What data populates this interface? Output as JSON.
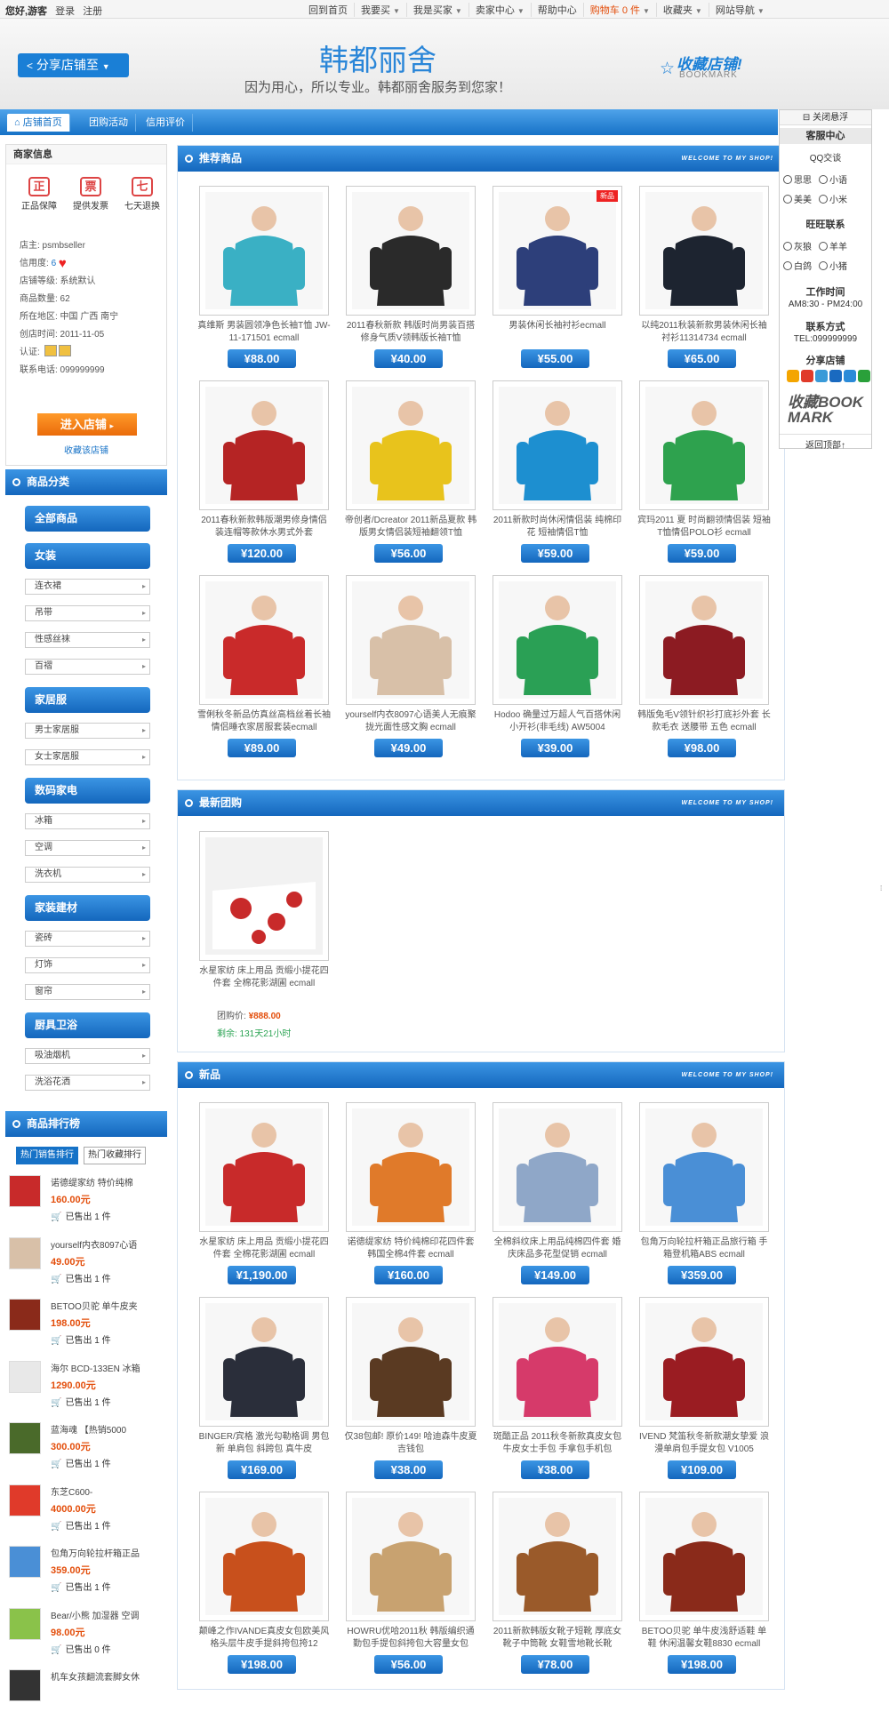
{
  "topbar": {
    "greeting": "您好,游客",
    "login": "登录",
    "register": "注册",
    "links": [
      "回到首页",
      "我要买",
      "我是买家",
      "卖家中心",
      "帮助中心",
      "购物车 0 件",
      "收藏夹",
      "网站导航"
    ]
  },
  "header": {
    "share": "分享店铺至",
    "store_name": "韩都丽舍",
    "slogan": "因为用心，所以专业。韩都丽舍服务到您家！",
    "fav_title": "收藏店铺!",
    "fav_sub": "BOOKMARK"
  },
  "nav": {
    "items": [
      "店铺首页",
      "团购活动",
      "信用评价"
    ]
  },
  "merchant": {
    "heading": "商家信息",
    "badges": [
      "正品保障",
      "提供发票",
      "七天退换"
    ],
    "owner": "店主: psmbseller",
    "credit_label": "信用度:",
    "credit_value": "6",
    "level": "店铺等级: 系统默认",
    "count": "商品数量: 62",
    "region": "所在地区: 中国  广西  南宁",
    "created": "创店时间: 2011-11-05",
    "cert": "认证:",
    "phone": "联系电话: 099999999",
    "enter": "进入店铺",
    "fav": "收藏该店铺"
  },
  "categories": {
    "heading": "商品分类",
    "groups": [
      {
        "name": "全部商品",
        "subs": []
      },
      {
        "name": "女装",
        "subs": [
          "连衣裙",
          "吊带",
          "性感丝袜",
          "百褶"
        ]
      },
      {
        "name": "家居服",
        "subs": [
          "男士家居服",
          "女士家居服"
        ]
      },
      {
        "name": "数码家电",
        "subs": [
          "冰箱",
          "空调",
          "洗衣机"
        ]
      },
      {
        "name": "家装建材",
        "subs": [
          "瓷砖",
          "灯饰",
          "窗帘"
        ]
      },
      {
        "name": "厨具卫浴",
        "subs": [
          "吸油烟机",
          "洗浴花洒"
        ]
      }
    ]
  },
  "ranking": {
    "heading": "商品排行榜",
    "tabs": [
      "热门销售排行",
      "热门收藏排行"
    ],
    "sold_label": "已售出",
    "items": [
      {
        "name": "诺德缇家纺 特价纯棉",
        "price": "160.00元",
        "sold": "1 件"
      },
      {
        "name": "yourself内衣8097心语",
        "price": "49.00元",
        "sold": "1 件"
      },
      {
        "name": "BETOO贝驼 单牛皮夹",
        "price": "198.00元",
        "sold": "1 件"
      },
      {
        "name": "海尔 BCD-133EN 冰箱",
        "price": "1290.00元",
        "sold": "1 件"
      },
      {
        "name": "蓝海魂 【热销5000",
        "price": "300.00元",
        "sold": "1 件"
      },
      {
        "name": "东芝C600-",
        "price": "4000.00元",
        "sold": "1 件"
      },
      {
        "name": "包角万向轮拉杆箱正品",
        "price": "359.00元",
        "sold": "1 件"
      },
      {
        "name": "Bear/小熊 加湿器 空调",
        "price": "98.00元",
        "sold": "0 件"
      },
      {
        "name": "机车女孩翻流套脚女休",
        "price": "",
        "sold": ""
      }
    ]
  },
  "recommended": {
    "heading": "推荐商品",
    "welcome": "WELCOME TO MY SHOP!",
    "items": [
      {
        "name": "真维斯 男装圆领净色长袖T恤 JW-11-171501 ecmall",
        "price": "¥88.00",
        "color": "#3ab0c4"
      },
      {
        "name": "2011春秋新款 韩版时尚男装百搭修身气质V领韩版长袖T恤",
        "price": "¥40.00",
        "color": "#2a2a2a"
      },
      {
        "name": "男装休闲长袖衬衫ecmall",
        "price": "¥55.00",
        "color": "#2d3f7a",
        "tag": "新品"
      },
      {
        "name": "以纯2011秋装新款男装休闲长袖衬衫11314734 ecmall",
        "price": "¥65.00",
        "color": "#1d2430"
      },
      {
        "name": "2011春秋新款韩版潮男修身情侣装连帽等款休水男式外套",
        "price": "¥120.00",
        "color": "#b52424"
      },
      {
        "name": "帝创者/Dcreator 2011新品夏款 韩版男女情侣装短袖翻领T恤",
        "price": "¥56.00",
        "color": "#e8c31c"
      },
      {
        "name": "2011新款时尚休闲情侣装 纯棉印花 短袖情侣T恤",
        "price": "¥59.00",
        "color": "#1d8fd0"
      },
      {
        "name": "宾玛2011 夏 时尚翻领情侣装 短袖T恤情侣POLO衫 ecmall",
        "price": "¥59.00",
        "color": "#2ea24e"
      },
      {
        "name": "雪俐秋冬新品仿真丝高档丝着长袖情侣睡衣家居服套装ecmall",
        "price": "¥89.00",
        "color": "#c92a2a"
      },
      {
        "name": "yourself内衣8097心语美人无痕聚拢光面性感文胸 ecmall",
        "price": "¥49.00",
        "color": "#d8c0a8"
      },
      {
        "name": "Hodoo 确量过万超人气百搭休闲小开衫(非毛线) AW5004",
        "price": "¥39.00",
        "color": "#2aa055"
      },
      {
        "name": "韩版兔毛V领针织衫打底衫外套 长款毛衣 送腰带 五色 ecmall",
        "price": "¥98.00",
        "color": "#8c1b22"
      }
    ]
  },
  "group_buy": {
    "heading": "最新团购",
    "welcome": "WELCOME TO MY SHOP!",
    "item": {
      "name": "水星家纺 床上用品 贡缎小提花四件套 全棉花影湖圃 ecmall",
      "price_label": "团购价:",
      "price": "¥888.00",
      "remaining": "剩余: 131天21小时",
      "color": "#c82a2a"
    }
  },
  "new_items": {
    "heading": "新品",
    "welcome": "WELCOME TO MY SHOP!",
    "items": [
      {
        "name": "水星家纺 床上用品 贡缎小提花四件套 全棉花影湖圃 ecmall",
        "price": "¥1,190.00",
        "color": "#c82a2a"
      },
      {
        "name": "诺德缇家纺 特价纯棉印花四件套 韩国全棉4件套 ecmall",
        "price": "¥160.00",
        "color": "#e07a2a"
      },
      {
        "name": "全棉斜纹床上用品纯棉四件套 婚庆床品多花型促销 ecmall",
        "price": "¥149.00",
        "color": "#8fa7c8"
      },
      {
        "name": "包角万向轮拉杆箱正品旅行箱 手箱登机箱ABS ecmall",
        "price": "¥359.00",
        "color": "#4a8fd6"
      },
      {
        "name": "BINGER/宾格 激光勾勒格调 男包 新 单肩包 斜跨包 真牛皮",
        "price": "¥169.00",
        "color": "#2a2e3a"
      },
      {
        "name": "仅38包邮! 原价149! 哈迪森牛皮夏吉钱包",
        "price": "¥38.00",
        "color": "#5a3a22"
      },
      {
        "name": "斑酷正品 2011秋冬新款真皮女包牛皮女士手包 手拿包手机包",
        "price": "¥38.00",
        "color": "#d63a6a"
      },
      {
        "name": "IVEND 梵笛秋冬新款潮女挚爱 浪漫单肩包手提女包 V1005",
        "price": "¥109.00",
        "color": "#9a1c22"
      },
      {
        "name": "颠峰之作IVANDE真皮女包欧美风格头层牛皮手提斜挎包挎12",
        "price": "¥198.00",
        "color": "#c8501c"
      },
      {
        "name": "HOWRU优哈2011秋 韩版编织通勤包手提包斜挎包大容量女包",
        "price": "¥56.00",
        "color": "#c8a270"
      },
      {
        "name": "2011新款韩版女靴子短靴 厚底女靴子中筒靴 女鞋雪地靴长靴",
        "price": "¥78.00",
        "color": "#9a5a2a"
      },
      {
        "name": "BETOO贝驼 单牛皮浅舒适鞋 单鞋 休闲温馨女鞋8830 ecmall",
        "price": "¥198.00",
        "color": "#8a2a1a"
      }
    ]
  },
  "cs": {
    "close": "关闭悬浮",
    "center": "客服中心",
    "qq": "QQ交谈",
    "qq_names": [
      "思思",
      "小语",
      "美美",
      "小米"
    ],
    "ww": "旺旺联系",
    "ww_names": [
      "灰狼",
      "羊羊",
      "白鸽",
      "小猪"
    ],
    "hours_label": "工作时间",
    "hours": "AM8:30 - PM24:00",
    "contact_label": "联系方式",
    "tel": "TEL:099999999",
    "share": "分享店铺",
    "bookmark": "收藏BOOK MARK",
    "back": "返回顶部↑"
  }
}
